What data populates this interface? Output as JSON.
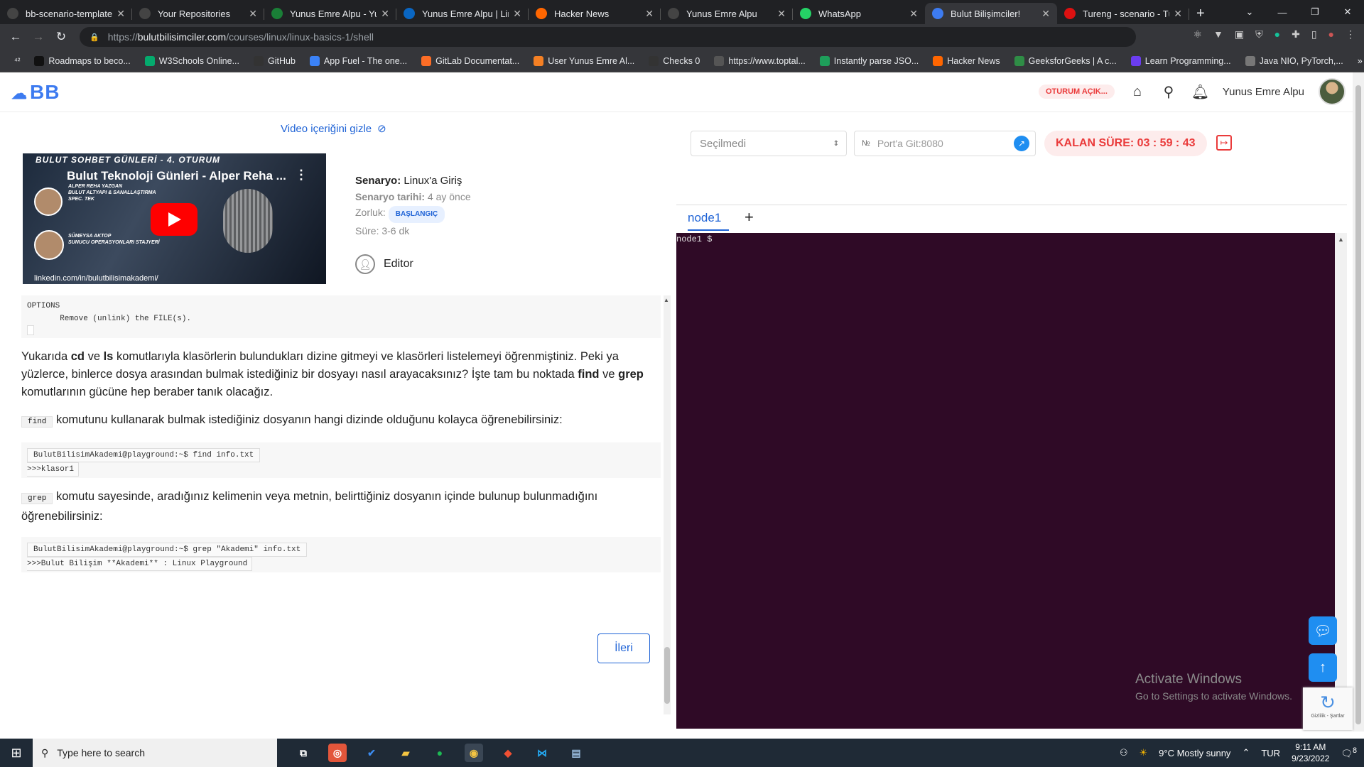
{
  "browser": {
    "tabs": [
      {
        "title": "bb-scenario-template",
        "favicon_color": "#444"
      },
      {
        "title": "Your Repositories",
        "favicon_color": "#444"
      },
      {
        "title": "Yunus Emre Alpu - Yunus",
        "favicon_color": "#1a7f37"
      },
      {
        "title": "Yunus Emre Alpu | LinkedIn",
        "favicon_color": "#0a66c2"
      },
      {
        "title": "Hacker News",
        "favicon_color": "#ff6600"
      },
      {
        "title": "Yunus Emre Alpu",
        "favicon_color": "#444"
      },
      {
        "title": "WhatsApp",
        "favicon_color": "#25d366"
      },
      {
        "title": "Bulut Bilişimciler!",
        "favicon_color": "#3d7bf0"
      },
      {
        "title": "Tureng - scenario - Türkçe",
        "favicon_color": "#d11"
      }
    ],
    "url_prefix": "https://",
    "url_host": "bulutbilisimciler.com",
    "url_path": "/courses/linux/linux-basics-1/shell",
    "bookmarks": [
      {
        "label": "Roadmaps to beco...",
        "color": "#111"
      },
      {
        "label": "W3Schools Online...",
        "color": "#04aa6d"
      },
      {
        "label": "GitHub",
        "color": "#333"
      },
      {
        "label": "App Fuel - The one...",
        "color": "#3b82f6"
      },
      {
        "label": "GitLab Documentat...",
        "color": "#fc6d26"
      },
      {
        "label": "User Yunus Emre Al...",
        "color": "#f48024"
      },
      {
        "label": "Checks 0",
        "color": "#333"
      },
      {
        "label": "https://www.toptal...",
        "color": "#555"
      },
      {
        "label": "Instantly parse JSO...",
        "color": "#1e9e5a"
      },
      {
        "label": "Hacker News",
        "color": "#ff6600"
      },
      {
        "label": "GeeksforGeeks | A c...",
        "color": "#2f8d46"
      },
      {
        "label": "Learn Programming...",
        "color": "#6b3df0"
      },
      {
        "label": "Java NIO, PyTorch,...",
        "color": "#777"
      }
    ]
  },
  "header": {
    "logo": "BB",
    "session_badge": "OTURUM AÇIK...",
    "user_name": "Yunus Emre Alpu"
  },
  "left": {
    "hide_video_label": "Video içeriğini gizle",
    "video": {
      "top_text": "BULUT SOHBET GÜNLERİ - 4. OTURUM",
      "title": "Bulut Teknoloji Günleri - Alper Reha ...",
      "caption_1": [
        "ALPER REHA YAZGAN",
        "BULUT ALTYAPI & SANALLAŞTIRMA",
        "SPEC. TEK"
      ],
      "caption_2": [
        "SÜMEYSA AKTOP",
        "SUNUCU OPERASYONLARI STAJYERİ"
      ],
      "link": "linkedin.com/in/bulutbilisimakademi/"
    },
    "meta": {
      "scenario_label": "Senaryo:",
      "scenario_value": "Linux'a Giriş",
      "date_label": "Senaryo tarihi:",
      "date_value": "4 ay önce",
      "difficulty_label": "Zorluk:",
      "difficulty_value": "BAŞLANGIÇ",
      "duration": "Süre: 3-6 dk",
      "editor_label": "Editor"
    },
    "code_options": {
      "line1": "OPTIONS",
      "line2": "       Remove (unlink) the FILE(s)."
    },
    "para1": {
      "t1": "Yukarıda ",
      "b1": "cd",
      "t2": " ve ",
      "b2": "ls",
      "t3": " komutlarıyla klasörlerin bulundukları dizine gitmeyi ve klasörleri listelemeyi öğrenmiştiniz. Peki ya yüzlerce, binlerce dosya arasından bulmak istediğiniz bir dosyayı nasıl arayacaksınız? İşte tam bu noktada ",
      "b3": "find",
      "t4": " ve ",
      "b4": "grep",
      "t5": " komutlarının gücüne hep beraber tanık olacağız."
    },
    "para2": {
      "code": "find",
      "text": " komutunu kullanarak bulmak istediğiniz dosyanın hangi dizinde olduğunu kolayca öğrenebilirsiniz:"
    },
    "code_find": {
      "cmd": "BulutBilisimAkademi@playground:~$ find info.txt",
      "out": ">>>klasor1"
    },
    "para3": {
      "code": "grep",
      "text": " komutu sayesinde, aradığınız kelimenin veya metnin, belirttiğiniz dosyanın içinde bulunup bulunmadığını öğrenebilirsiniz:"
    },
    "code_grep": {
      "cmd": "BulutBilisimAkademi@playground:~$ grep \"Akademi\" info.txt",
      "out": ">>>Bulut Bilişim **Akademi** : Linux Playground"
    },
    "next_button": "İleri"
  },
  "right": {
    "select_value": "Seçilmedi",
    "port_prefix": "№",
    "port_placeholder": "Port'a Git:8080",
    "timer": "KALAN SÜRE: 03 : 59 : 43",
    "tab": "node1",
    "add_tab": "+",
    "prompt": "node1 $"
  },
  "overlay": {
    "activate_1": "Activate Windows",
    "activate_2": "Go to Settings to activate Windows.",
    "recaptcha": "Gizlilik - Şartlar"
  },
  "taskbar": {
    "search_placeholder": "Type here to search",
    "weather": "9°C  Mostly sunny",
    "lang": "TUR",
    "time": "9:11 AM",
    "date": "9/23/2022",
    "notif_count": "8"
  }
}
